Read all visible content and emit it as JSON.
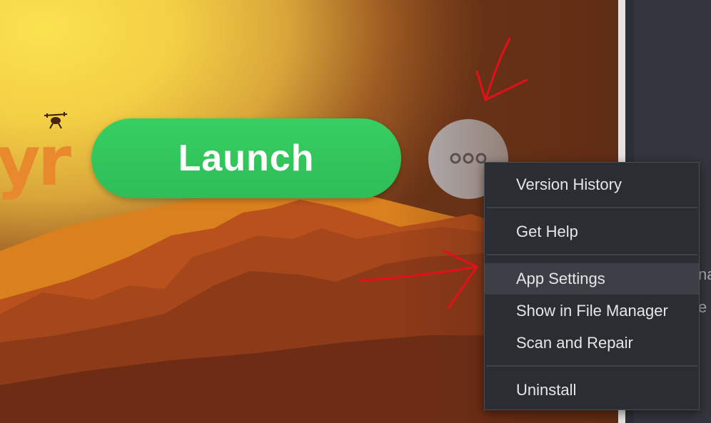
{
  "banner": {
    "logo_fragment": "yr",
    "launch_label": "Launch",
    "more_icon": "more-horizontal-icon"
  },
  "menu": {
    "items": [
      {
        "label": "Version History"
      },
      {
        "label": "Get Help"
      },
      {
        "label": "App Settings",
        "highlighted": true
      },
      {
        "label": "Show in File Manager"
      },
      {
        "label": "Scan and Repair"
      },
      {
        "label": "Uninstall"
      }
    ]
  },
  "side_panel": {
    "peek_text_1": "na",
    "peek_text_2": "e"
  },
  "colors": {
    "launch_green": "#33c65c",
    "menu_bg": "#2a2d32",
    "highlight_bg": "#3c3f45",
    "annotation_red": "#e3101a"
  },
  "annotations": [
    "red-arrow-icon",
    "red-arrow-icon"
  ]
}
